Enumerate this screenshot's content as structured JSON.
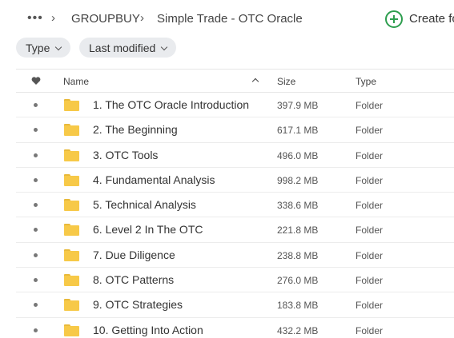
{
  "breadcrumb": {
    "more": "•••",
    "items": [
      "GROUPBUY",
      "Simple Trade - OTC Oracle"
    ]
  },
  "create": {
    "label": "Create fo",
    "icon": "plus-circle-icon",
    "color": "#2e9e4f"
  },
  "filters": [
    {
      "label": "Type"
    },
    {
      "label": "Last modified"
    }
  ],
  "table": {
    "headers": {
      "name": "Name",
      "size": "Size",
      "type": "Type"
    },
    "sort": "name-ascending",
    "rows": [
      {
        "name": "1. The OTC Oracle Introduction",
        "size": "397.9 MB",
        "type": "Folder"
      },
      {
        "name": "2. The Beginning",
        "size": "617.1 MB",
        "type": "Folder"
      },
      {
        "name": "3. OTC Tools",
        "size": "496.0 MB",
        "type": "Folder"
      },
      {
        "name": "4. Fundamental Analysis",
        "size": "998.2 MB",
        "type": "Folder"
      },
      {
        "name": "5. Technical Analysis",
        "size": "338.6 MB",
        "type": "Folder"
      },
      {
        "name": "6. Level 2 In The OTC",
        "size": "221.8 MB",
        "type": "Folder"
      },
      {
        "name": "7. Due Diligence",
        "size": "238.8 MB",
        "type": "Folder"
      },
      {
        "name": "8. OTC Patterns",
        "size": "276.0 MB",
        "type": "Folder"
      },
      {
        "name": "9. OTC Strategies",
        "size": "183.8 MB",
        "type": "Folder"
      },
      {
        "name": "10. Getting Into Action",
        "size": "432.2 MB",
        "type": "Folder"
      }
    ]
  },
  "colors": {
    "folder": "#f7c948",
    "accent": "#2e9e4f"
  }
}
